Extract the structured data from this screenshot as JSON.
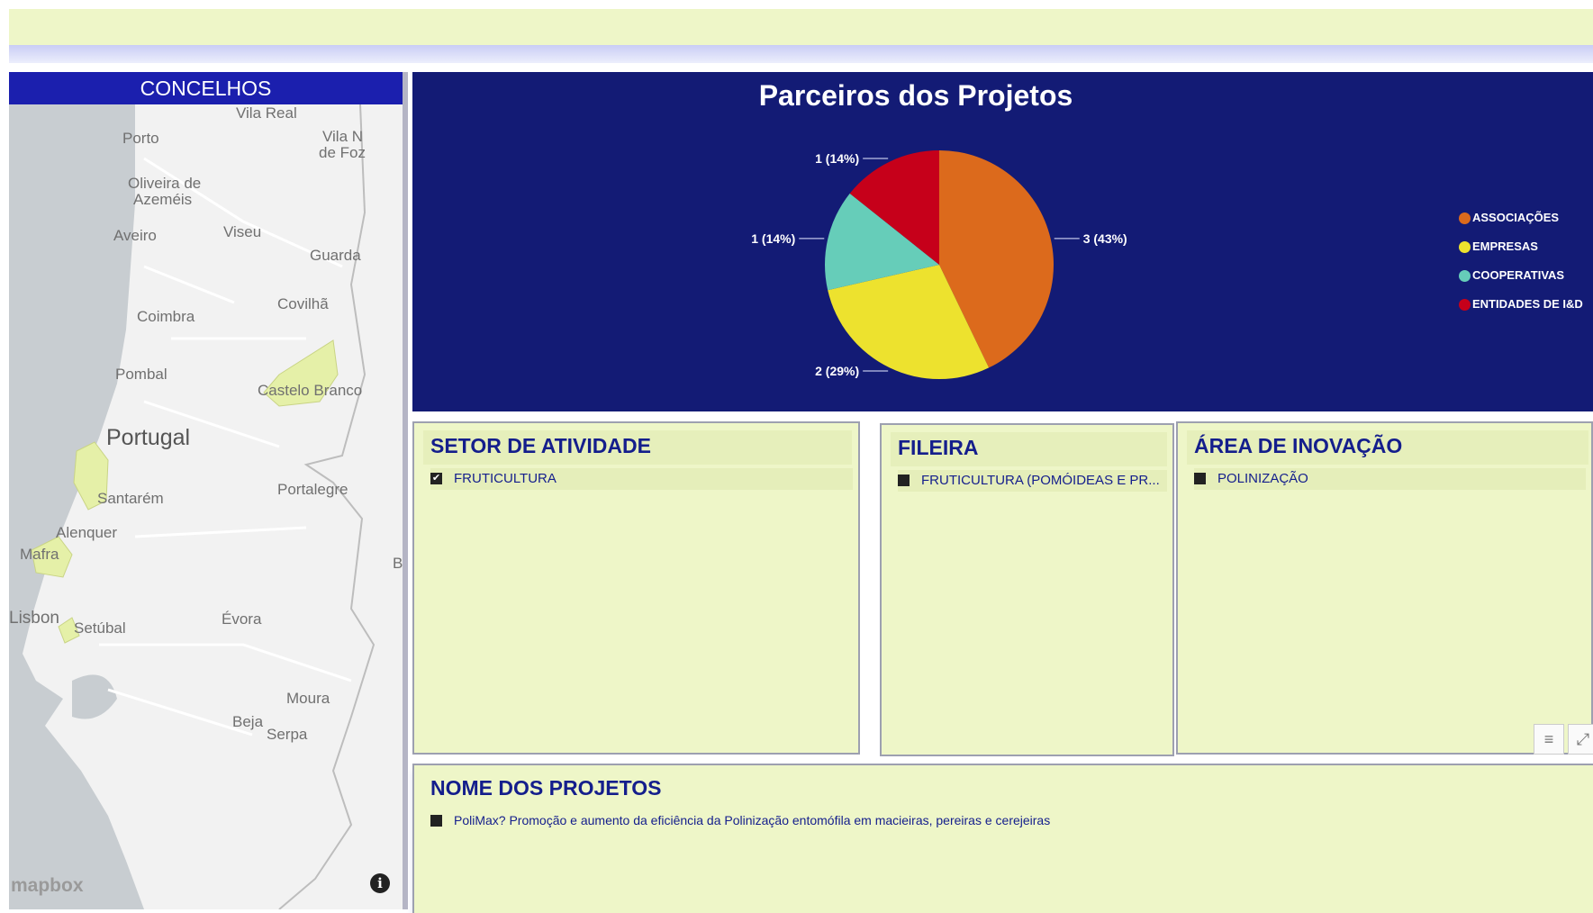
{
  "map": {
    "title": "CONCELHOS",
    "cities": [
      {
        "name": "Vila Real"
      },
      {
        "name": "Porto"
      },
      {
        "name": "Vila N"
      },
      {
        "name": "de Foz"
      },
      {
        "name": "Oliveira de"
      },
      {
        "name": "Azeméis"
      },
      {
        "name": "Aveiro"
      },
      {
        "name": "Viseu"
      },
      {
        "name": "Guarda"
      },
      {
        "name": "Covilhã"
      },
      {
        "name": "Coimbra"
      },
      {
        "name": "Pombal"
      },
      {
        "name": "Castelo Branco"
      },
      {
        "name": "Portugal"
      },
      {
        "name": "Portalegre"
      },
      {
        "name": "Santarém"
      },
      {
        "name": "Alenquer"
      },
      {
        "name": "Mafra"
      },
      {
        "name": "Lisbon"
      },
      {
        "name": "Setúbal"
      },
      {
        "name": "Évora"
      },
      {
        "name": "Moura"
      },
      {
        "name": "Beja"
      },
      {
        "name": "Serpa"
      },
      {
        "name": "B"
      }
    ],
    "logo": "mapbox",
    "info_glyph": "i",
    "colors": {
      "land": "#f2f2f2",
      "water": "#c8cdd1",
      "highlight": "#e5f0a8",
      "header": "#1b1fae"
    }
  },
  "chart_data": {
    "type": "pie",
    "title": "Parceiros dos Projetos",
    "slices": [
      {
        "label": "ASSOCIAÇÕES",
        "value": 3,
        "data_label": "3 (43%)",
        "color": "#dc6a1c"
      },
      {
        "label": "EMPRESAS",
        "value": 2,
        "data_label": "2 (29%)",
        "color": "#ede22e"
      },
      {
        "label": "COOPERATIVAS",
        "value": 1,
        "data_label": "1 (14%)",
        "color": "#66cdb9"
      },
      {
        "label": "ENTIDADES DE I&D",
        "value": 1,
        "data_label": "1 (14%)",
        "color": "#c6001a"
      }
    ],
    "legend_position": "right"
  },
  "cards": {
    "setor": {
      "title": "SETOR DE ATIVIDADE",
      "item": "FRUTICULTURA",
      "check": "✔"
    },
    "fileira": {
      "title": "FILEIRA",
      "item": "FRUTICULTURA (POMÓIDEAS E PR..."
    },
    "area": {
      "title": "ÁREA DE INOVAÇÃO",
      "item": "POLINIZAÇÃO"
    },
    "projetos": {
      "title": "NOME DOS PROJETOS",
      "item": "PoliMax? Promoção e aumento da eficiência da Polinização entomófila em macieiras, pereiras e cerejeiras"
    }
  },
  "visual_header": {
    "filter_icon": "filter-icon",
    "focus_icon": "focus-mode-icon"
  },
  "theme": {
    "panel_bg": "#131b75",
    "card_bg": "#eef6c8",
    "title_color": "#141e8c"
  }
}
